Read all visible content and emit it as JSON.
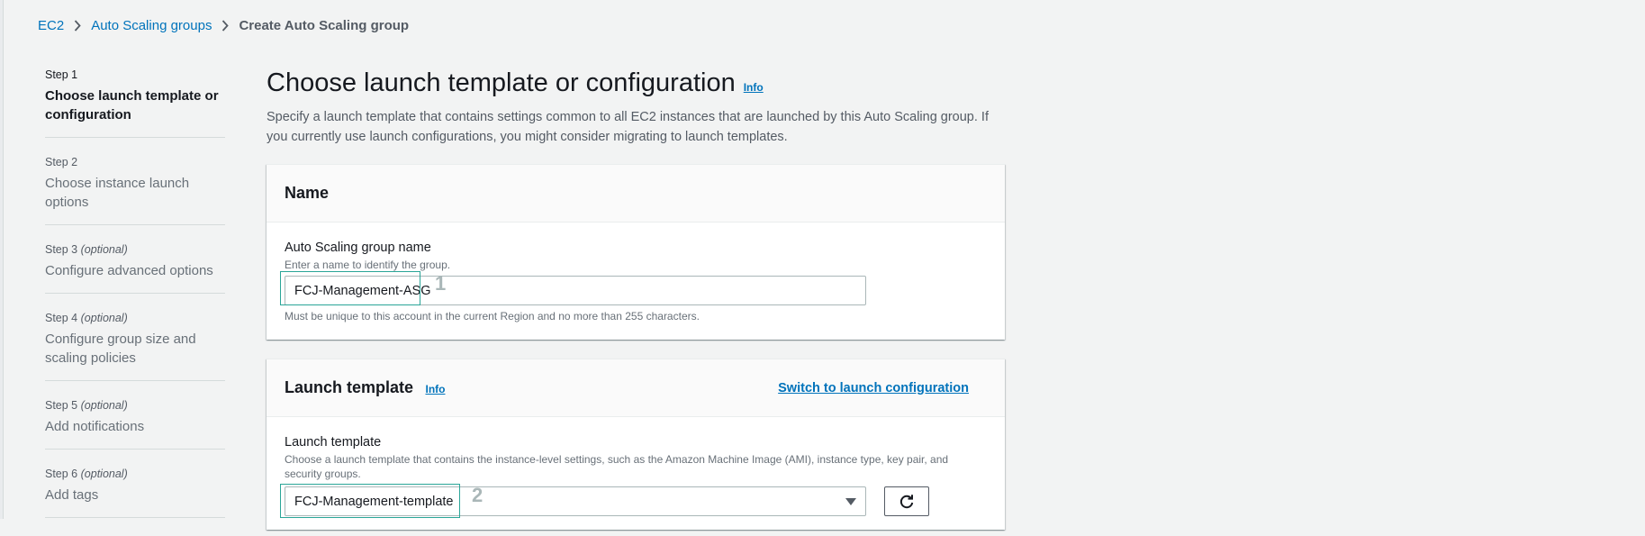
{
  "breadcrumb": {
    "items": [
      {
        "label": "EC2"
      },
      {
        "label": "Auto Scaling groups"
      }
    ],
    "current": "Create Auto Scaling group"
  },
  "steps": [
    {
      "num": "Step 1",
      "optional": "",
      "title": "Choose launch template or configuration",
      "active": true
    },
    {
      "num": "Step 2",
      "optional": "",
      "title": "Choose instance launch options",
      "active": false
    },
    {
      "num": "Step 3",
      "optional": "(optional)",
      "title": "Configure advanced options",
      "active": false
    },
    {
      "num": "Step 4",
      "optional": "(optional)",
      "title": "Configure group size and scaling policies",
      "active": false
    },
    {
      "num": "Step 5",
      "optional": "(optional)",
      "title": "Add notifications",
      "active": false
    },
    {
      "num": "Step 6",
      "optional": "(optional)",
      "title": "Add tags",
      "active": false
    }
  ],
  "main": {
    "title": "Choose launch template or configuration",
    "info": "Info",
    "description": "Specify a launch template that contains settings common to all EC2 instances that are launched by this Auto Scaling group. If you currently use launch configurations, you might consider migrating to launch templates."
  },
  "name_panel": {
    "title": "Name",
    "field_label": "Auto Scaling group name",
    "field_desc": "Enter a name to identify the group.",
    "value": "FCJ-Management-ASG",
    "constraint": "Must be unique to this account in the current Region and no more than 255 characters.",
    "annotation": "1"
  },
  "launch_template_panel": {
    "title": "Launch template",
    "info": "Info",
    "switch_link": "Switch to launch configuration",
    "field_label": "Launch template",
    "field_desc": "Choose a launch template that contains the instance-level settings, such as the Amazon Machine Image (AMI), instance type, key pair, and security groups.",
    "selected": "FCJ-Management-template",
    "annotation": "2"
  },
  "colors": {
    "link": "#0073bb",
    "highlight": "#2aa598",
    "background": "#f2f3f3"
  }
}
